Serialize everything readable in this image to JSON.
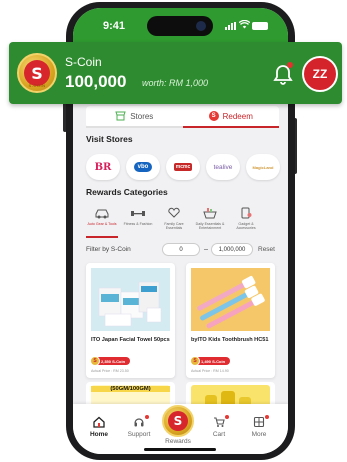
{
  "status_bar": {
    "time": "9:41"
  },
  "header": {
    "brand": "S-Coin",
    "balance": "100,000",
    "worth": "worth: RM 1,000",
    "avatar_initials": "ZZ",
    "coin_letter": "S",
    "coin_ring_text": "S-COIN"
  },
  "tabs": [
    {
      "label": "Stores",
      "active": false,
      "icon": "store-icon"
    },
    {
      "label": "Redeem",
      "active": true,
      "icon": "s-coin-icon"
    }
  ],
  "visit_stores": {
    "title": "Visit Stores",
    "stores": [
      {
        "name": "BR",
        "color": "#d81e5b",
        "icon": "baskin-robbins-logo"
      },
      {
        "name": "vbo",
        "color": "#1565c0",
        "icon": "vbo-logo"
      },
      {
        "name": "mcmc",
        "color": "#c62828",
        "icon": "mcmc-logo"
      },
      {
        "name": "tealive",
        "color": "#7b5ea7",
        "icon": "tealive-logo"
      },
      {
        "name": "MagicLand",
        "color": "#d19a3a",
        "icon": "magicland-logo"
      }
    ]
  },
  "rewards_categories": {
    "title": "Rewards Categories",
    "items": [
      {
        "label": "Auto Gear & Tools",
        "icon": "car-icon",
        "active": true
      },
      {
        "label": "Fitness & Fashion",
        "icon": "dumbbell-icon",
        "active": false
      },
      {
        "label": "Family Care Essentials",
        "icon": "heart-hands-icon",
        "active": false
      },
      {
        "label": "Daily Essentials & Entertainment",
        "icon": "basket-icon",
        "active": false
      },
      {
        "label": "Gadget & Accessories",
        "icon": "gadget-icon",
        "active": false
      }
    ]
  },
  "filter": {
    "label": "Filter by S-Coin",
    "min_value": "0",
    "max_value": "1,000,000",
    "reset_label": "Reset"
  },
  "products": [
    {
      "title": "ITO Japan Facial Towel 50pcs",
      "price": "2,350 S-Coin",
      "actual": "Actual Price : RM 23.50",
      "image": "facial-towel-image"
    },
    {
      "title": "byITO Kids Toothbrush HC51",
      "price": "1,490 S-Coin",
      "actual": "Actual Price : RM 14.90",
      "image": "toothbrush-image"
    }
  ],
  "products_row2": [
    {
      "label": "(50GM/100GM)",
      "image": "food-product-image"
    },
    {
      "label": "",
      "image": "bottle-product-image"
    }
  ],
  "bottom_nav": [
    {
      "label": "Home",
      "icon": "home-icon",
      "active": true,
      "dot": false
    },
    {
      "label": "Support",
      "icon": "headset-icon",
      "active": false,
      "dot": true
    },
    {
      "label": "Rewards",
      "icon": "s-coin-icon",
      "active": false,
      "dot": false
    },
    {
      "label": "Cart",
      "icon": "cart-icon",
      "active": false,
      "dot": true
    },
    {
      "label": "More",
      "icon": "grid-icon",
      "active": false,
      "dot": true
    }
  ],
  "colors": {
    "brand_green": "#2e8b2f",
    "accent_red": "#c8252b",
    "coin_gold": "#d9a520"
  }
}
